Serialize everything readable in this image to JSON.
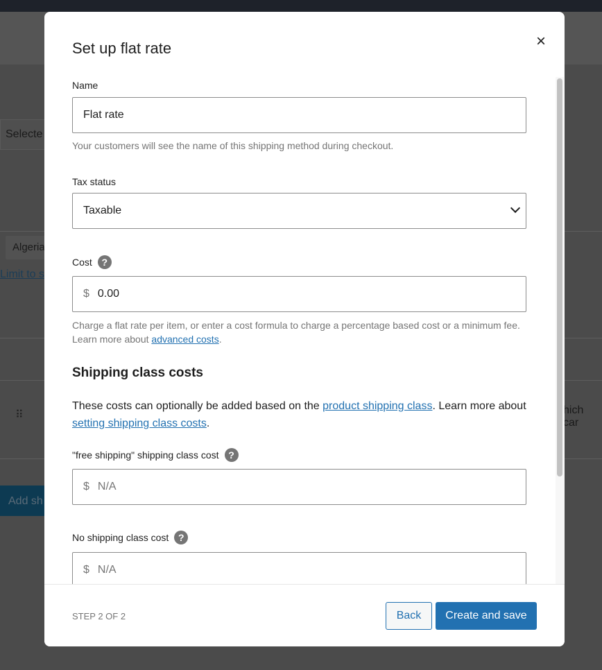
{
  "background": {
    "select_fragment": "Selecte",
    "chip_fragment": "Algeria",
    "link_fragment": "Limit to s",
    "text_fragment": "hich car",
    "button_fragment": "Add sh"
  },
  "modal": {
    "title": "Set up flat rate",
    "close_icon": "×",
    "name": {
      "label": "Name",
      "value": "Flat rate",
      "hint": "Your customers will see the name of this shipping method during checkout."
    },
    "tax_status": {
      "label": "Tax status",
      "value": "Taxable"
    },
    "cost": {
      "label": "Cost",
      "currency": "$",
      "value": "0.00",
      "hint": "Charge a flat rate per item, or enter a cost formula to charge a percentage based cost or a minimum fee. Learn more about ",
      "hint_link": "advanced costs",
      "hint_end": "."
    },
    "shipping_class": {
      "heading": "Shipping class costs",
      "text1": "These costs can optionally be added based on the ",
      "link1": "product shipping class",
      "text2": ". Learn more about ",
      "link2": "setting shipping class costs",
      "text3": ".",
      "free_label": "\"free shipping\" shipping class cost",
      "free_placeholder": "N/A",
      "none_label": "No shipping class cost",
      "none_placeholder": "N/A",
      "currency": "$"
    },
    "help_icon": "?",
    "footer": {
      "step": "STEP 2 OF 2",
      "back": "Back",
      "create": "Create and save"
    }
  },
  "colors": {
    "primary": "#2271b1",
    "overlay": "#4b4b4b"
  }
}
